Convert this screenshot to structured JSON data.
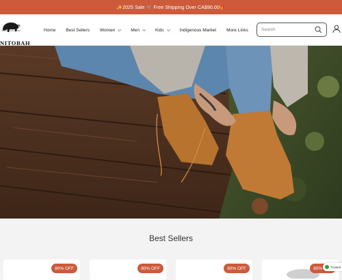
{
  "announcement": {
    "text": "✨2025 Sale 🛒 Free Shipping Over CA$90.00🎁"
  },
  "header": {
    "logo_text": "NITOBAH",
    "nav": [
      {
        "label": "Home",
        "has_dropdown": false
      },
      {
        "label": "Best Sellers",
        "has_dropdown": false
      },
      {
        "label": "Women",
        "has_dropdown": true
      },
      {
        "label": "Men",
        "has_dropdown": true
      },
      {
        "label": "Kids",
        "has_dropdown": true
      },
      {
        "label": "Indigenous Market",
        "has_dropdown": false
      },
      {
        "label": "More Links",
        "has_dropdown": false
      }
    ],
    "search": {
      "placeholder": "Search",
      "value": ""
    }
  },
  "best_sellers": {
    "title": "Best Sellers",
    "products": [
      {
        "badge": "80% OFF"
      },
      {
        "badge": "80% OFF"
      },
      {
        "badge": "80% OFF"
      },
      {
        "badge": "80% OFF"
      }
    ]
  },
  "trusted_badge": {
    "text": "Trusted"
  },
  "colors": {
    "accent": "#cc5a3b",
    "text": "#222222",
    "background": "#f3f3f3"
  }
}
